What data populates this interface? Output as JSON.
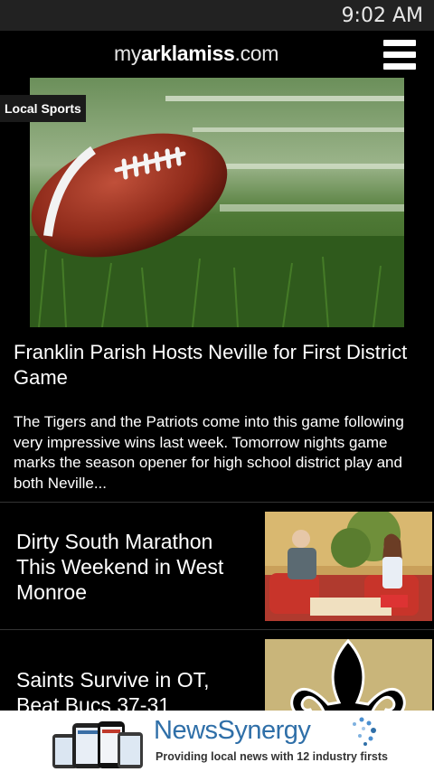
{
  "status_bar": {
    "time": "9:02 AM"
  },
  "header": {
    "logo_prefix": "my",
    "logo_bold": "arklamiss",
    "logo_suffix": ".com",
    "menu_icon": "hamburger-menu-icon"
  },
  "featured": {
    "section_tag": "Local Sports",
    "image_icon": "football-photo",
    "title": "Franklin Parish Hosts Neville for First District Game",
    "summary": "The Tigers and the Patriots come into this game following very impressive wins last week. Tomorrow nights game marks the season opener for high school district play and both Neville..."
  },
  "stories": [
    {
      "title": "Dirty South Marathon This Weekend in West Monroe",
      "thumb": "tv-interview-photo"
    },
    {
      "title": "Saints Survive in OT, Beat Bucs 37-31",
      "thumb": "saints-fleur-de-lis-logo"
    }
  ],
  "ad": {
    "brand": "NewsSynergy",
    "tagline": "Providing local news with 12 industry firsts"
  },
  "colors": {
    "background": "#000000",
    "status_bar": "#222222",
    "ad_brand": "#2f6fa8",
    "saints_gold": "#c9b57a"
  }
}
